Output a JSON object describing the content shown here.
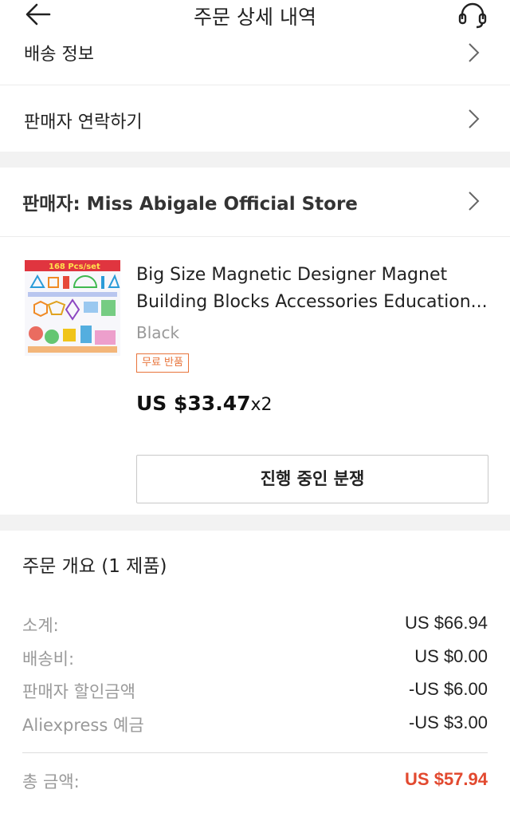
{
  "header": {
    "title": "주문 상세 내역",
    "back_icon": "back-arrow-icon",
    "service_icon": "headset-icon"
  },
  "links": {
    "shipping_info": "배송 정보",
    "contact_seller": "판매자 연락하기"
  },
  "store": {
    "label": "판매자: Miss Abigale Official Store"
  },
  "product": {
    "thumbnail_banner": "168 Pcs/set",
    "title": "Big Size Magnetic Designer Magnet Building Blocks Accessories Education...",
    "variant": "Black",
    "badge": "무료 반품",
    "price": "US $33.47",
    "quantity": "x2",
    "dispute_button": "진행 중인 분쟁"
  },
  "summary": {
    "title": "주문 개요 (1 제품)",
    "rows": [
      {
        "label": "소계:",
        "value": "US $66.94"
      },
      {
        "label": "배송비:",
        "value": "US $0.00"
      },
      {
        "label": "판매자 할인금액",
        "value": "-US $6.00"
      },
      {
        "label": "Aliexpress 예금",
        "value": "-US $3.00"
      }
    ],
    "total_label": "총 금액:",
    "total_value": "US $57.94"
  },
  "colors": {
    "accent": "#e2492f",
    "badge": "#e8743b",
    "gap": "#f2f2f2"
  }
}
